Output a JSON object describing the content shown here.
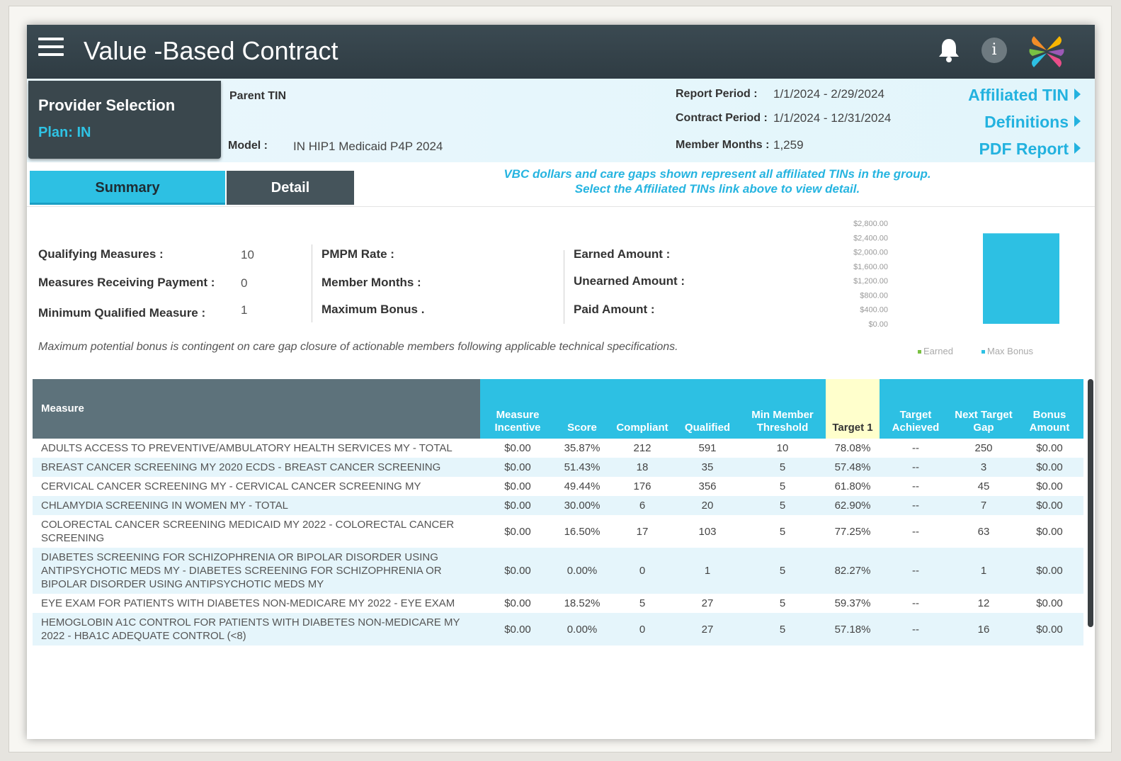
{
  "app": {
    "title": "Value -Based Contract",
    "bell_icon": "bell-icon",
    "info_label": "i"
  },
  "provider": {
    "title": "Provider Selection",
    "plan": "Plan: IN"
  },
  "header": {
    "parent_tin_label": "Parent TIN",
    "model_label": "Model :",
    "model_value": "IN HIP1 Medicaid P4P 2024",
    "report_period_label": "Report Period :",
    "report_period_value": "1/1/2024 - 2/29/2024",
    "contract_period_label": "Contract Period :",
    "contract_period_value": "1/1/2024 - 12/31/2024",
    "member_months_label": "Member Months :",
    "member_months_value": "1,259"
  },
  "links": {
    "affiliated": "Affiliated TIN",
    "definitions": "Definitions",
    "pdf": "PDF Report"
  },
  "tabs": {
    "summary": "Summary",
    "detail": "Detail"
  },
  "notice": {
    "line1": "VBC dollars and care gaps shown represent all affiliated TINs in the group.",
    "line2": "Select the Affiliated TINs link above to view detail."
  },
  "summary": {
    "qualifying_label": "Qualifying Measures :",
    "qualifying_value": "10",
    "receiving_label": "Measures Receiving Payment :",
    "receiving_value": "0",
    "min_qualified_label": "Minimum Qualified Measure :",
    "min_qualified_value": "1",
    "pmpm_label": "PMPM Rate :",
    "member_months_label": "Member Months :",
    "max_bonus_label": "Maximum Bonus .",
    "earned_label": "Earned Amount :",
    "unearned_label": "Unearned Amount :",
    "paid_label": "Paid Amount :",
    "disclaimer": "Maximum potential bonus is contingent on care gap closure of actionable members following applicable technical specifications."
  },
  "chart_data": {
    "type": "bar",
    "categories": [
      ""
    ],
    "y_ticks": [
      "$2,800.00",
      "$2,400.00",
      "$2,000.00",
      "$1,600.00",
      "$1,200.00",
      "$800.00",
      "$400.00",
      "$0.00"
    ],
    "ylim": [
      0,
      2800
    ],
    "series": [
      {
        "name": "Earned",
        "values": [
          0
        ],
        "color": "#7ac142"
      },
      {
        "name": "Max Bonus",
        "values": [
          2518
        ],
        "color": "#2dc0e3"
      }
    ],
    "legend": "bottom-right"
  },
  "table": {
    "headers": [
      "Measure",
      "Measure Incentive",
      "Score",
      "Compliant",
      "Qualified",
      "Min Member Threshold",
      "Target 1",
      "Target Achieved",
      "Next Target Gap",
      "Bonus Amount"
    ],
    "rows": [
      [
        "ADULTS ACCESS TO PREVENTIVE/AMBULATORY HEALTH SERVICES MY  - TOTAL",
        "$0.00",
        "35.87%",
        "212",
        "591",
        "10",
        "78.08%",
        "--",
        "250",
        "$0.00"
      ],
      [
        "BREAST CANCER SCREENING MY 2020 ECDS - BREAST CANCER SCREENING",
        "$0.00",
        "51.43%",
        "18",
        "35",
        "5",
        "57.48%",
        "--",
        "3",
        "$0.00"
      ],
      [
        "CERVICAL CANCER SCREENING MY  - CERVICAL CANCER SCREENING MY",
        "$0.00",
        "49.44%",
        "176",
        "356",
        "5",
        "61.80%",
        "--",
        "45",
        "$0.00"
      ],
      [
        "CHLAMYDIA SCREENING IN WOMEN MY  - TOTAL",
        "$0.00",
        "30.00%",
        "6",
        "20",
        "5",
        "62.90%",
        "--",
        "7",
        "$0.00"
      ],
      [
        "COLORECTAL CANCER SCREENING MEDICAID MY 2022 - COLORECTAL CANCER SCREENING",
        "$0.00",
        "16.50%",
        "17",
        "103",
        "5",
        "77.25%",
        "--",
        "63",
        "$0.00"
      ],
      [
        "DIABETES SCREENING FOR SCHIZOPHRENIA OR BIPOLAR DISORDER USING ANTIPSYCHOTIC MEDS MY  - DIABETES SCREENING FOR SCHIZOPHRENIA OR BIPOLAR DISORDER USING ANTIPSYCHOTIC MEDS MY",
        "$0.00",
        "0.00%",
        "0",
        "1",
        "5",
        "82.27%",
        "--",
        "1",
        "$0.00"
      ],
      [
        "EYE EXAM FOR PATIENTS WITH DIABETES NON-MEDICARE MY 2022 - EYE EXAM",
        "$0.00",
        "18.52%",
        "5",
        "27",
        "5",
        "59.37%",
        "--",
        "12",
        "$0.00"
      ],
      [
        "HEMOGLOBIN A1C CONTROL FOR PATIENTS WITH DIABETES NON-MEDICARE MY 2022 - HBA1C ADEQUATE CONTROL (<8)",
        "$0.00",
        "0.00%",
        "0",
        "27",
        "5",
        "57.18%",
        "--",
        "16",
        "$0.00"
      ]
    ]
  }
}
